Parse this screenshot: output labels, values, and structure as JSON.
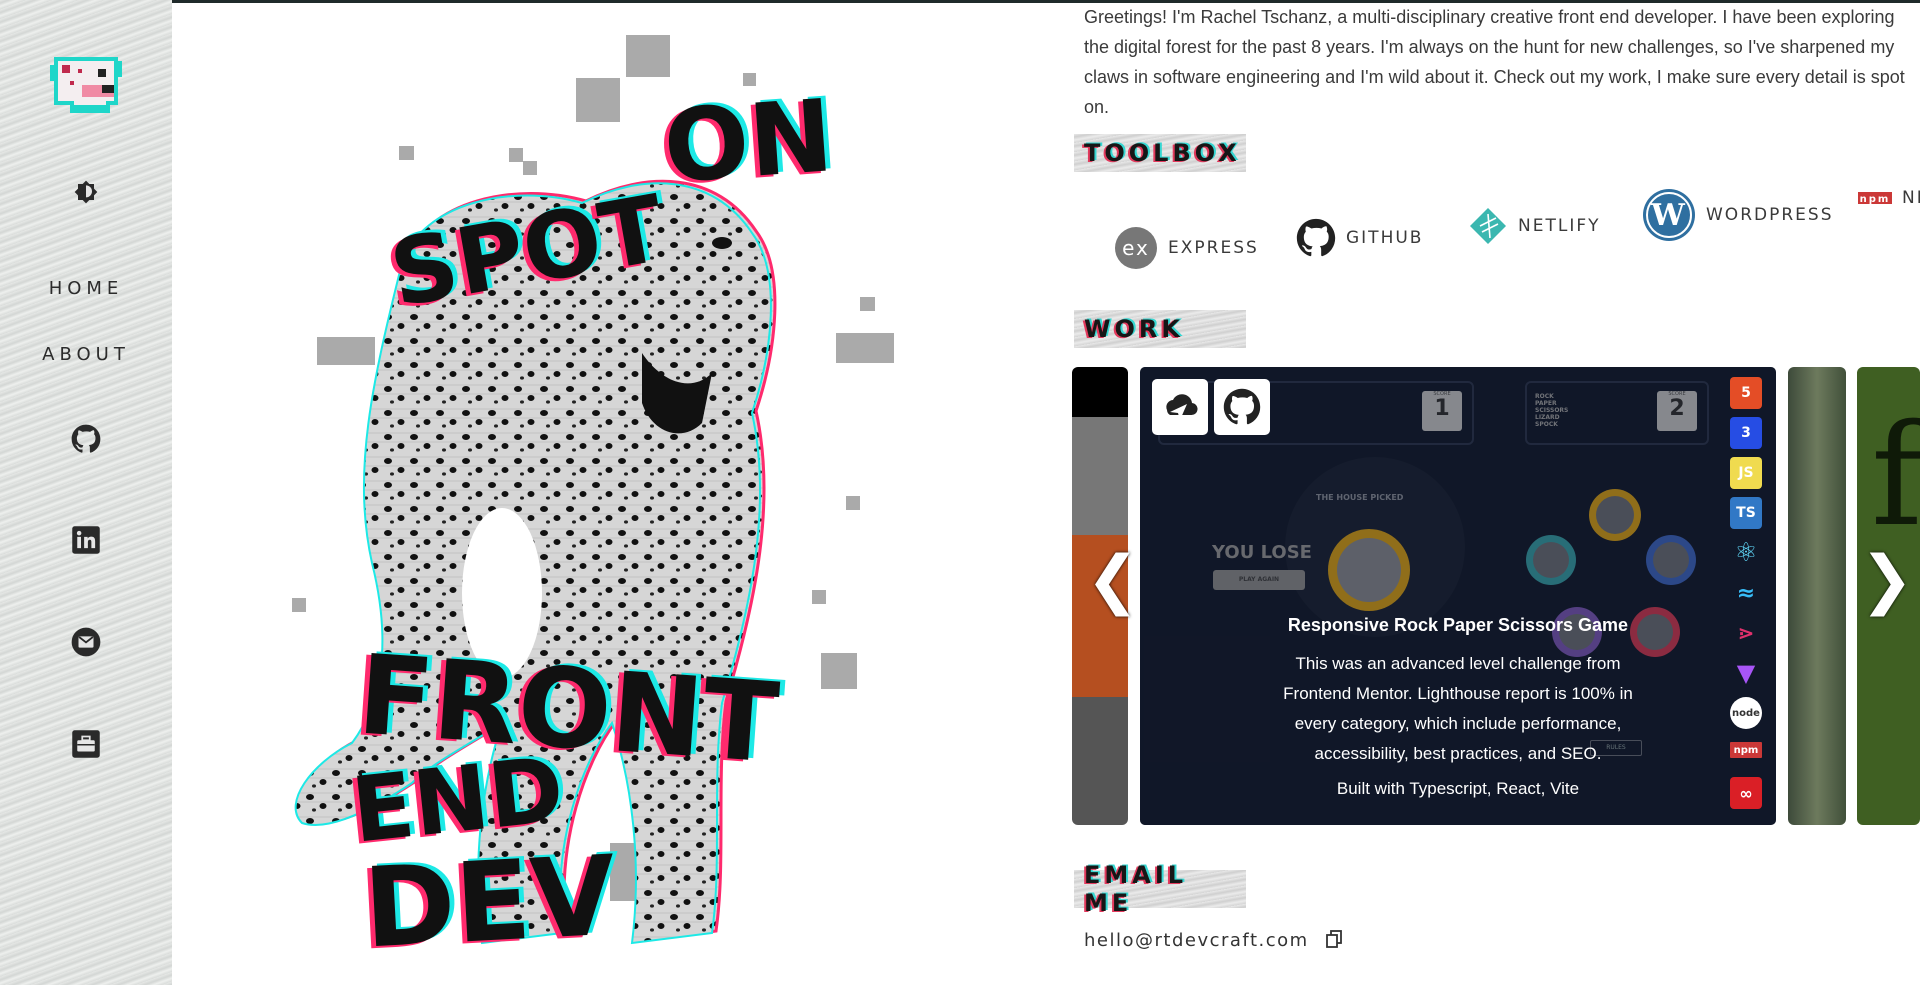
{
  "sidebar": {
    "logo_icon": "pixel-cheetah-logo-icon",
    "theme_icon": "brightness-icon",
    "nav": [
      {
        "label": "HOME"
      },
      {
        "label": "ABOUT"
      }
    ],
    "social": [
      {
        "icon": "github-icon"
      },
      {
        "icon": "linkedin-icon"
      },
      {
        "icon": "email-icon"
      },
      {
        "icon": "briefcase-icon"
      }
    ]
  },
  "hero": {
    "line1": "SPOT",
    "line2": "ON",
    "line3": "FRONT",
    "line4": "END",
    "line5": "DEV",
    "image_icon": "cheetah-illustration",
    "colors": {
      "glitch_red": "#ff2a6d",
      "glitch_cyan": "#1de9e6"
    }
  },
  "about": {
    "intro": "Greetings! I'm Rachel Tschanz, a multi-disciplinary creative front end developer. I have been exploring the digital forest for the past 8 years. I'm always on the hunt for new challenges, so I've sharpened my claws in software engineering and I'm wild about it. Check out my work, I make sure every detail is spot on."
  },
  "toolbox": {
    "title": "TOOLBOX",
    "tools": [
      {
        "label": "EXPRESS",
        "icon": "express-icon"
      },
      {
        "label": "GITHUB",
        "icon": "github-icon"
      },
      {
        "label": "NETLIFY",
        "icon": "netlify-icon"
      },
      {
        "label": "WORDPRESS",
        "icon": "wordpress-icon"
      },
      {
        "label": "NP",
        "icon": "npm-icon"
      }
    ]
  },
  "work": {
    "title": "WORK",
    "project": {
      "title": "Responsive Rock Paper Scissors Game",
      "description": "This was an advanced level challenge from Frontend Mentor. Lighthouse report is 100% in every category, which include performance, accessibility, best practices, and SEO.",
      "built_with": "Built with Typescript, React, Vite",
      "buttons": [
        {
          "icon": "live-site-icon"
        },
        {
          "icon": "github-icon"
        }
      ],
      "tech_icons": [
        "html5-icon",
        "css3-icon",
        "js-icon",
        "ts-icon",
        "react-icon",
        "tailwind-icon",
        "graphql-icon",
        "vite-icon",
        "node-icon",
        "npm-icon",
        "creative-cloud-icon"
      ],
      "screenshot": {
        "score_label_1": "SCORE",
        "score_1": "1",
        "score_label_2": "SCORE",
        "score_2": "2",
        "brand_lines": [
          "ROCK",
          "PAPER",
          "SCISSORS",
          "LIZARD",
          "SPOCK"
        ],
        "house_picked": "THE HOUSE PICKED",
        "result": "YOU LOSE",
        "play_again": "PLAY AGAIN",
        "rules": "RULES"
      }
    },
    "arrows": {
      "prev": "❮",
      "next": "❯"
    }
  },
  "email": {
    "title": "EMAIL ME",
    "address": "hello@rtdevcraft.com",
    "copy_icon": "copy-icon"
  }
}
